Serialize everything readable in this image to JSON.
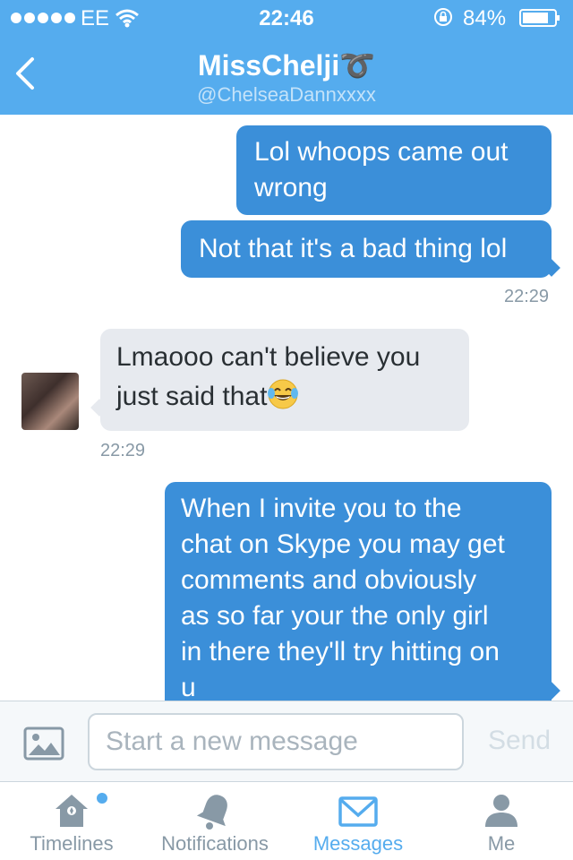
{
  "status_bar": {
    "carrier": "EE",
    "time": "22:46",
    "battery": "84%"
  },
  "nav": {
    "title": "MissChelji",
    "title_symbol": "➰",
    "handle": "@ChelseaDannxxxx",
    "back_icon": "chevron-left-icon"
  },
  "messages": [
    {
      "direction": "outgoing",
      "lines": [
        "Lol whoops came out",
        "wrong"
      ]
    },
    {
      "direction": "outgoing",
      "lines": [
        "Not that it's a bad thing lol"
      ],
      "timestamp": "22:29"
    },
    {
      "direction": "incoming",
      "lines": [
        "Lmaooo can't believe you",
        "just said that"
      ],
      "emoji": "face-with-tears-of-joy",
      "timestamp": "22:29"
    },
    {
      "direction": "outgoing",
      "lines": [
        "When I invite you to the",
        "chat on Skype you may get",
        "comments and obviously",
        "as so far your the only girl",
        "in there they'll try hitting on",
        "u"
      ]
    }
  ],
  "compose": {
    "placeholder": "Start a new message",
    "send_label": "Send",
    "photo_icon": "photo-icon"
  },
  "tabs": [
    {
      "label": "Timelines",
      "icon": "home-icon",
      "has_dot": true
    },
    {
      "label": "Notifications",
      "icon": "bell-icon"
    },
    {
      "label": "Messages",
      "icon": "envelope-icon",
      "active": true
    },
    {
      "label": "Me",
      "icon": "person-icon"
    }
  ],
  "colors": {
    "brand": "#55acee",
    "outgoing_bubble": "#3b8fd9",
    "incoming_bubble": "#e7eaef",
    "tab_inactive": "#8899a6"
  }
}
